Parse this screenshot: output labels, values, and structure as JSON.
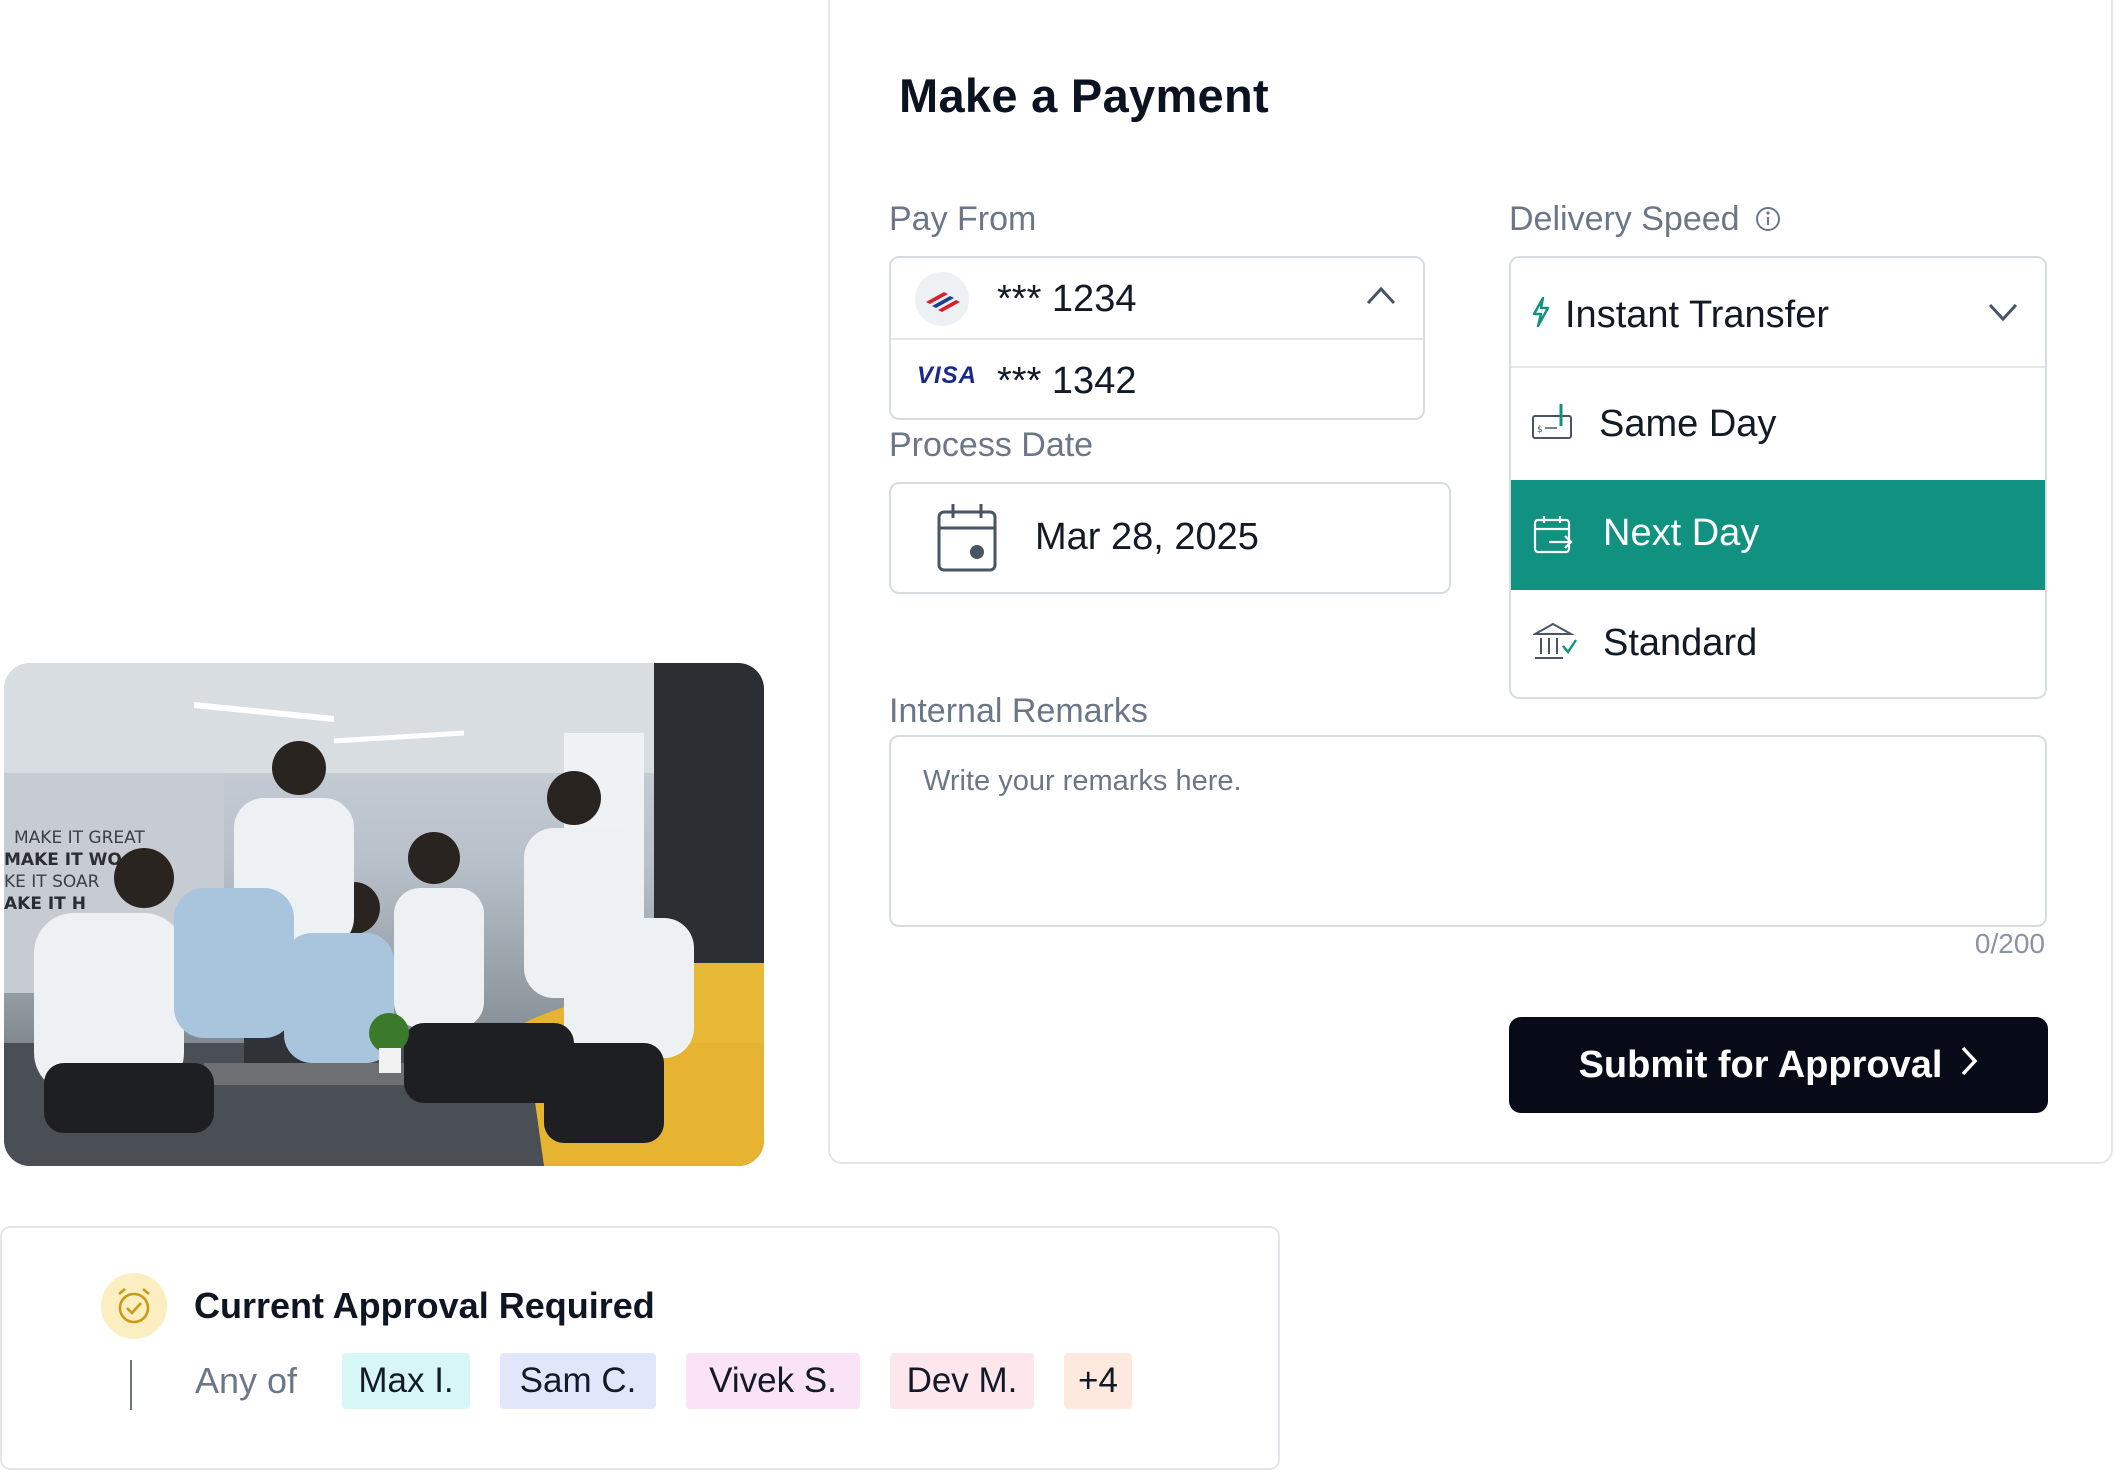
{
  "payment": {
    "title": "Make a Payment",
    "pay_from_label": "Pay From",
    "accounts": [
      {
        "icon": "bank-flag-logo-icon",
        "number": "*** 1234"
      },
      {
        "icon": "visa-logo-icon",
        "brand": "VISA",
        "number": "*** 1342"
      }
    ],
    "process_date_label": "Process Date",
    "process_date": "Mar 28, 2025",
    "delivery_speed_label": "Delivery Speed",
    "delivery_speed": {
      "selected_display": "Instant Transfer",
      "options": [
        "Same Day",
        "Next Day",
        "Standard"
      ],
      "highlighted": "Next Day"
    },
    "remarks_label": "Internal Remarks",
    "remarks_placeholder": "Write your remarks here.",
    "remarks_counter": "0/200",
    "submit_label": "Submit for Approval"
  },
  "approval": {
    "title": "Current Approval Required",
    "any_of": "Any of",
    "approvers": [
      "Max I.",
      "Sam C.",
      "Vivek S.",
      "Dev M.",
      "+4"
    ]
  },
  "colors": {
    "accent": "#11917f",
    "button": "#060b17",
    "chip_colors": [
      "#d7f6f8",
      "#e1e6fb",
      "#fbe3f7",
      "#fde6ec",
      "#fde9de"
    ]
  }
}
